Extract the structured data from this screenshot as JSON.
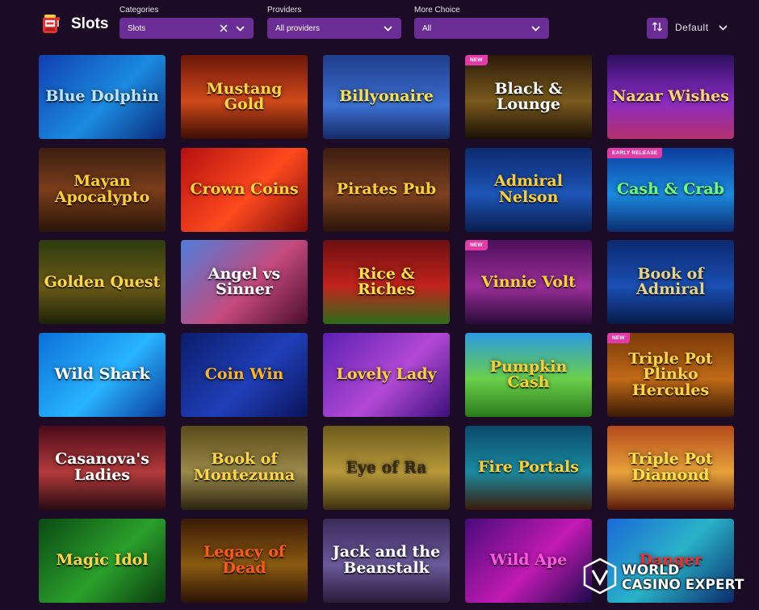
{
  "header": {
    "title": "Slots",
    "categories": {
      "label": "Categories",
      "value": "Slots"
    },
    "providers": {
      "label": "Providers",
      "value": "All providers"
    },
    "more_choice": {
      "label": "More Choice",
      "value": "All"
    },
    "sort": {
      "value": "Default"
    }
  },
  "games": [
    {
      "title": "Blue Dolphin",
      "badge": ""
    },
    {
      "title": "Mustang Gold",
      "badge": ""
    },
    {
      "title": "Billyonaire",
      "badge": ""
    },
    {
      "title": "Black & Lounge",
      "badge": "NEW"
    },
    {
      "title": "Nazar Wishes",
      "badge": ""
    },
    {
      "title": "Mayan Apocalypto",
      "badge": ""
    },
    {
      "title": "Crown Coins",
      "badge": ""
    },
    {
      "title": "Pirates Pub",
      "badge": ""
    },
    {
      "title": "Admiral Nelson",
      "badge": ""
    },
    {
      "title": "Cash & Crab",
      "badge": "EARLY RELEASE"
    },
    {
      "title": "Golden Quest",
      "badge": ""
    },
    {
      "title": "Angel vs Sinner",
      "badge": ""
    },
    {
      "title": "Rice & Riches",
      "badge": ""
    },
    {
      "title": "Vinnie Volt",
      "badge": "NEW"
    },
    {
      "title": "Book of Admiral",
      "badge": ""
    },
    {
      "title": "Wild Shark",
      "badge": ""
    },
    {
      "title": "Coin Win",
      "badge": ""
    },
    {
      "title": "Lovely Lady",
      "badge": ""
    },
    {
      "title": "Pumpkin Cash",
      "badge": ""
    },
    {
      "title": "Triple Pot Plinko Hercules",
      "badge": "NEW"
    },
    {
      "title": "Casanova's Ladies",
      "badge": ""
    },
    {
      "title": "Book of Montezuma",
      "badge": ""
    },
    {
      "title": "Eye of Ra",
      "badge": ""
    },
    {
      "title": "Fire Portals",
      "badge": ""
    },
    {
      "title": "Triple Pot Diamond",
      "badge": ""
    },
    {
      "title": "Magic Idol",
      "badge": ""
    },
    {
      "title": "Legacy of Dead",
      "badge": ""
    },
    {
      "title": "Jack and the Beanstalk",
      "badge": ""
    },
    {
      "title": "Wild Ape",
      "badge": ""
    },
    {
      "title": "Danger",
      "badge": ""
    }
  ],
  "watermark": {
    "line1": "WORLD",
    "line2": "CASINO EXPERT"
  },
  "colors": {
    "background": "#1c0b24",
    "select": "#6a2d96",
    "badge": "#e23aa7"
  },
  "icons": {
    "brand": "slot-machine-icon",
    "clear": "close-icon",
    "dropdown": "chevron-down-icon",
    "sort": "sort-arrows-icon"
  }
}
